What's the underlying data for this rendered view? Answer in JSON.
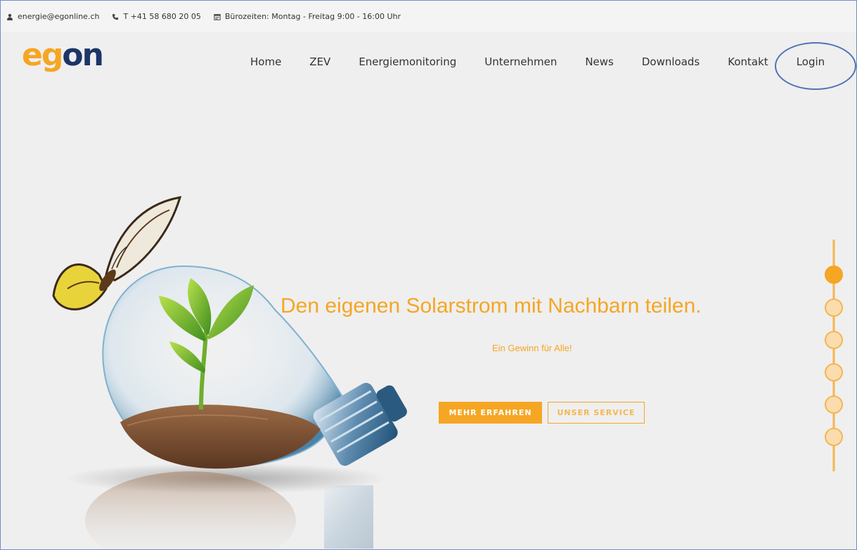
{
  "topbar": {
    "email": "energie@egonline.ch",
    "phone": "T +41 58 680 20 05",
    "hours": "Bürozeiten: Montag - Freitag 9:00 - 16:00 Uhr"
  },
  "logo": {
    "part1": "e",
    "part2": "g",
    "part3": "on"
  },
  "nav": [
    {
      "label": "Home"
    },
    {
      "label": "ZEV"
    },
    {
      "label": "Energiemonitoring"
    },
    {
      "label": "Unternehmen"
    },
    {
      "label": "News"
    },
    {
      "label": "Downloads"
    },
    {
      "label": "Kontakt"
    },
    {
      "label": "Login"
    }
  ],
  "hero": {
    "headline": "Den eigenen Solarstrom mit Nachbarn teilen.",
    "subline": "Ein Gewinn für Alle!",
    "primary_button": "MEHR ERFAHREN",
    "secondary_button": "UNSER SERVICE"
  },
  "slider": {
    "count": 6,
    "active": 1
  },
  "colors": {
    "accent": "#f5a623",
    "brand_dark": "#1d3567",
    "annotation": "#4f73b6"
  },
  "icons": [
    "user-icon",
    "phone-icon",
    "calendar-icon"
  ]
}
